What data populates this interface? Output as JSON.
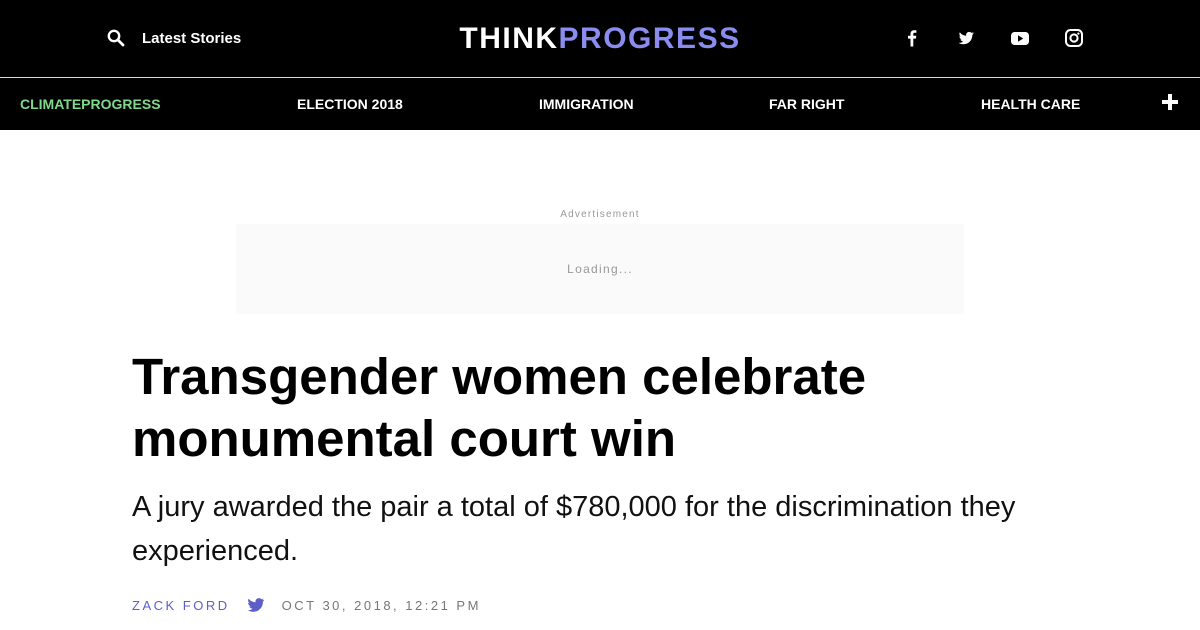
{
  "header": {
    "latest_label": "Latest Stories",
    "logo_part1": "THINK",
    "logo_part2": "PROGRESS",
    "logo_colors": {
      "think": "#ffffff",
      "progress": "#8a8cf0"
    },
    "social_icons": [
      "facebook-icon",
      "twitter-icon",
      "youtube-icon",
      "instagram-icon"
    ]
  },
  "nav": {
    "items": [
      {
        "label": "CLIMATEPROGRESS",
        "color": "#7fd98c"
      },
      {
        "label": "ELECTION 2018"
      },
      {
        "label": "IMMIGRATION"
      },
      {
        "label": "FAR RIGHT"
      },
      {
        "label": "HEALTH CARE"
      }
    ],
    "more_icon": "plus-icon"
  },
  "ad": {
    "label": "Advertisement",
    "loading": "Loading..."
  },
  "article": {
    "headline": "Transgender women celebrate monumental court win",
    "dek": "A jury awarded the pair a total of $780,000 for the discrimination they experienced.",
    "author": "ZACK FORD",
    "date": "OCT 30, 2018, 12:21 PM",
    "accent_color": "#5b5fc7"
  }
}
